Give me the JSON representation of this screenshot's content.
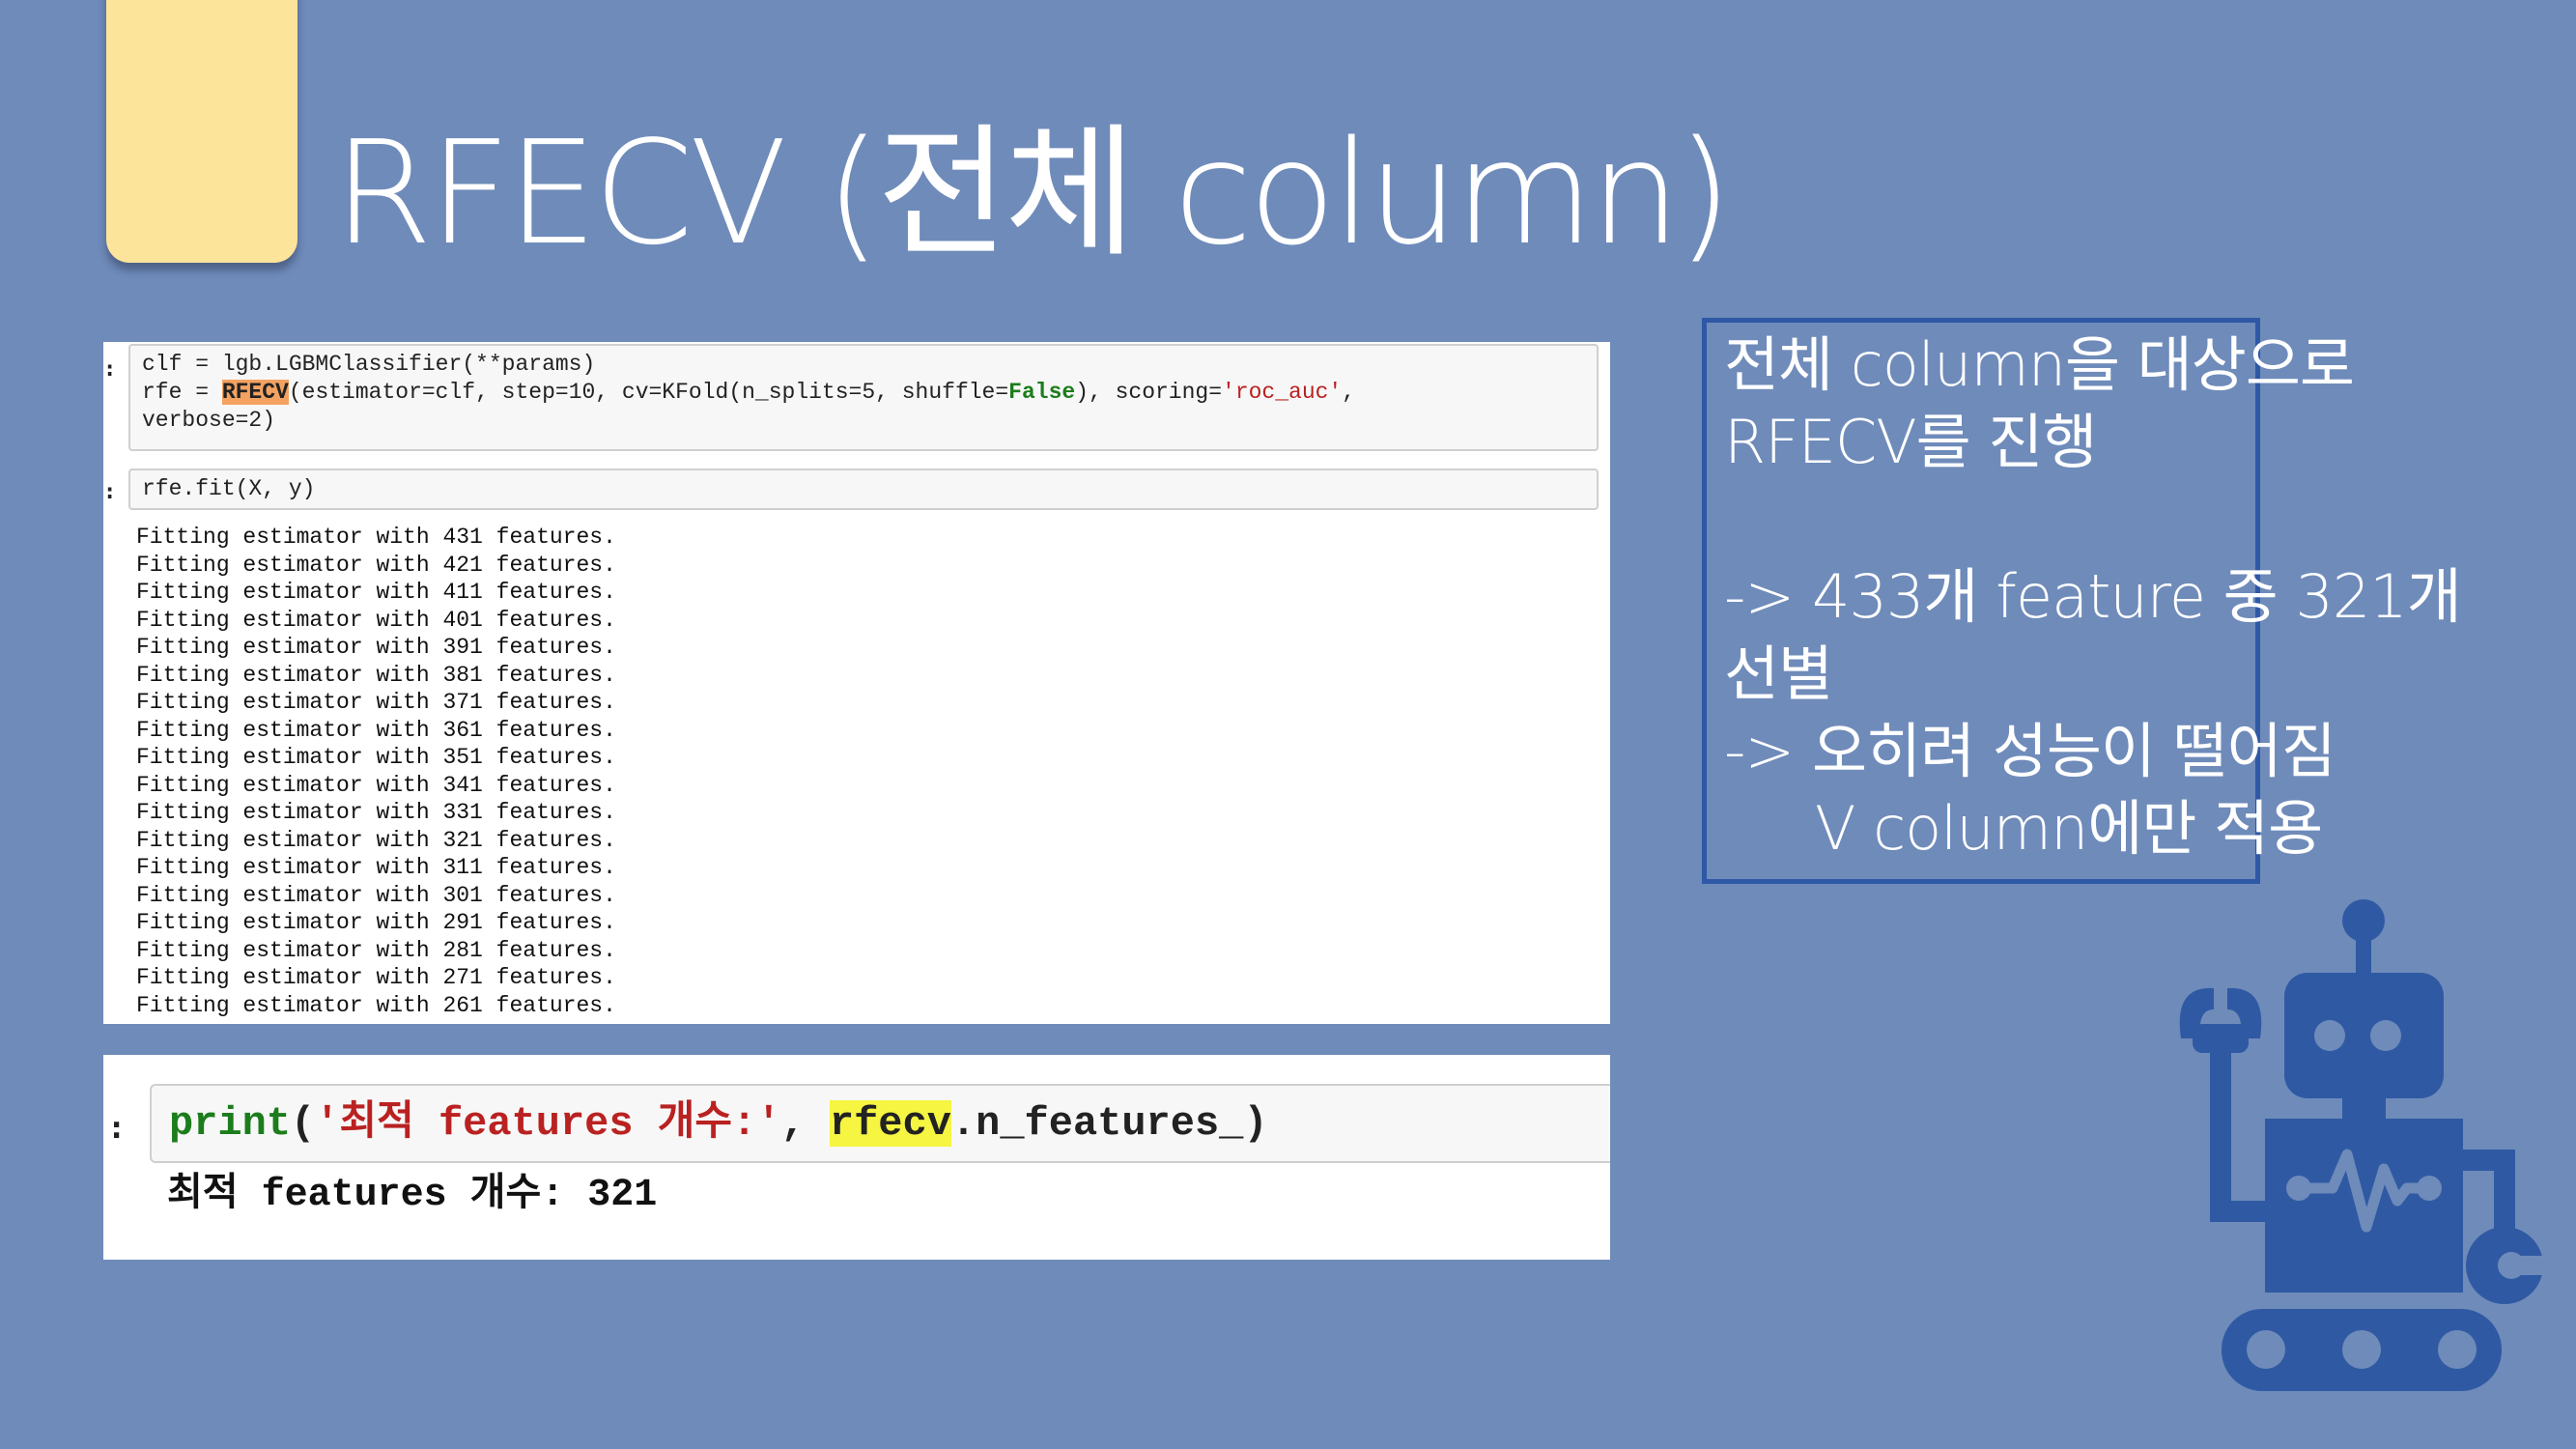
{
  "slide": {
    "title": "RFECV (전체 column)"
  },
  "code_panel_1": {
    "prompt_1": ":",
    "line_1": "clf = lgb.LGBMClassifier(**params)",
    "line_2_pre": "rfe = ",
    "line_2_hl": "RFECV",
    "line_2_mid": "(estimator=clf, step=10, cv=KFold(n_splits=5, shuffle=",
    "line_2_false": "False",
    "line_2_scoring": "), scoring=",
    "line_2_str": "'roc_auc'",
    "line_2_end": ",",
    "line_3": "verbose=2)",
    "prompt_2": ":",
    "fit_line": "rfe.fit(X, y)",
    "output_lines": [
      "Fitting estimator with 431 features.",
      "Fitting estimator with 421 features.",
      "Fitting estimator with 411 features.",
      "Fitting estimator with 401 features.",
      "Fitting estimator with 391 features.",
      "Fitting estimator with 381 features.",
      "Fitting estimator with 371 features.",
      "Fitting estimator with 361 features.",
      "Fitting estimator with 351 features.",
      "Fitting estimator with 341 features.",
      "Fitting estimator with 331 features.",
      "Fitting estimator with 321 features.",
      "Fitting estimator with 311 features.",
      "Fitting estimator with 301 features.",
      "Fitting estimator with 291 features.",
      "Fitting estimator with 281 features.",
      "Fitting estimator with 271 features.",
      "Fitting estimator with 261 features."
    ]
  },
  "code_panel_2": {
    "prompt": ":",
    "print_fn": "print",
    "open_paren": "(",
    "string": "'최적 features 개수:'",
    "comma": ", ",
    "hl_var": "rfecv",
    "attr": ".n_features_)",
    "output": "최적 features 개수: 321"
  },
  "note": {
    "lines": [
      "전체 column을 대상으로",
      "RFECV를 진행",
      "",
      "-> 433개 feature 중 321개",
      "선별",
      "-> 오히려 성능이 떨어짐",
      "V column에만 적용"
    ]
  },
  "colors": {
    "background": "#6f8bba",
    "tab": "#fde49b",
    "note_border": "#2e58a6",
    "robot": "#2f5aa3",
    "highlight_orange": "#f4a261",
    "highlight_yellow": "#f5f542"
  },
  "icons": [
    "robot-icon"
  ]
}
